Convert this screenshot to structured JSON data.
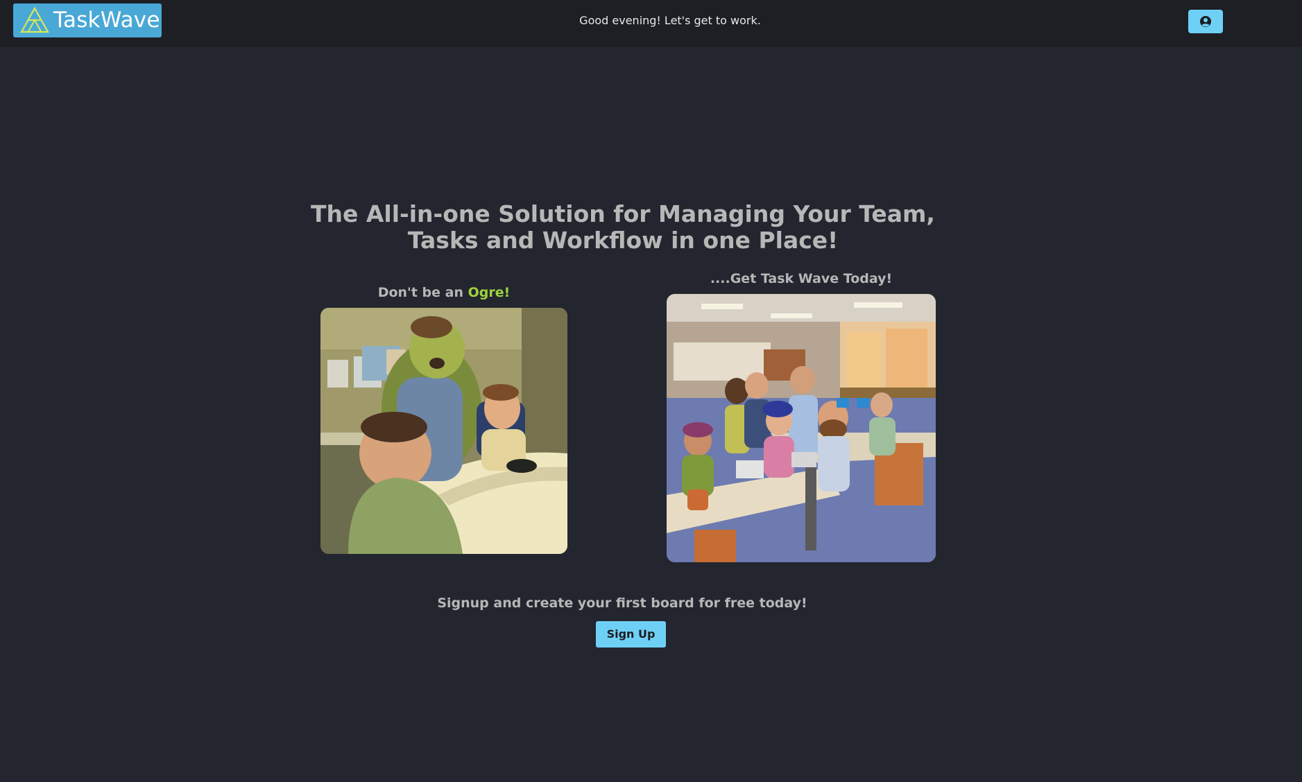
{
  "navbar": {
    "logo_text": "TaskWave",
    "greeting": "Good evening! Let's get to work.",
    "profile_icon": "user-circle-icon"
  },
  "hero": {
    "title": "The All-in-one Solution for Managing Your Team, Tasks and Workflow in one Place!"
  },
  "left_panel": {
    "caption_prefix": "Don't be an ",
    "caption_accent": "Ogre!",
    "image": "ogre-office-illustration"
  },
  "right_panel": {
    "caption": "....Get Task Wave Today!",
    "image": "happy-team-office-illustration"
  },
  "cta": {
    "text": "Signup and create your first board for free today!",
    "button_label": "Sign Up"
  },
  "colors": {
    "page_bg": "#23262f",
    "navbar_bg": "#1d1f24",
    "logo_bg": "#4aa8d6",
    "button_bg": "#6fd0f5",
    "accent_green": "#9ed33d",
    "heading_text": "#b7b7b7"
  }
}
